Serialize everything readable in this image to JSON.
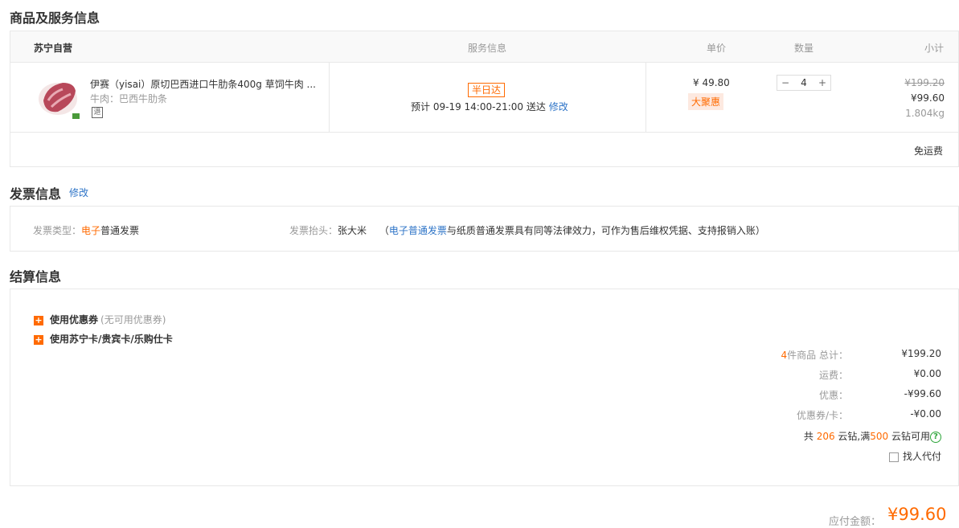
{
  "goods_section": {
    "title": "商品及服务信息",
    "header": {
      "store": "苏宁自营",
      "service": "服务信息",
      "unit_price": "单价",
      "quantity": "数量",
      "subtotal": "小计"
    },
    "item": {
      "name": "伊赛（yisai）原切巴西进口牛肋条400g 草饲牛肉 ...",
      "attr": "牛肉：巴西牛肋条",
      "return_mark": "退",
      "service_tag": "半日达",
      "delivery_prefix": "预计",
      "delivery_time": "09-19 14:00-21:00",
      "delivery_suffix": "送达",
      "modify_link": "修改",
      "price": "¥ 49.80",
      "promo_tag": "大聚惠",
      "qty_minus": "−",
      "qty_value": "4",
      "qty_plus": "+",
      "original_total": "¥199.20",
      "subtotal": "¥99.60",
      "weight": "1.804kg"
    },
    "shipping": "免运费"
  },
  "invoice_section": {
    "title": "发票信息",
    "modify_link": "修改",
    "type_label": "发票类型：",
    "type_highlight": "电子",
    "type_value": "普通发票",
    "header_label": "发票抬头：",
    "header_value": "张大米",
    "note_open": "（",
    "note_link": "电子普通发票",
    "note_text": "与纸质普通发票具有同等法律效力，可作为售后维权凭据、支持报销入账）"
  },
  "settle_section": {
    "title": "结算信息",
    "coupon_label": "使用优惠券",
    "coupon_note": "(无可用优惠券)",
    "card_label": "使用苏宁卡/贵宾卡/乐购仕卡",
    "summary": {
      "count": "4",
      "count_label": "件商品 总计：",
      "total": "¥199.20",
      "freight_label": "运费：",
      "freight": "¥0.00",
      "discount_label": "优惠：",
      "discount": "-¥99.60",
      "coupon_card_label": "优惠券/卡：",
      "coupon_card": "-¥0.00",
      "cloud_prefix": "共",
      "cloud_total": "206",
      "cloud_mid": "云钻,满",
      "cloud_min": "500",
      "cloud_suffix": "云钻可用",
      "help_glyph": "?",
      "proxy_pay": "找人代付"
    }
  },
  "payable": {
    "label": "应付金额：",
    "amount": "¥99.60"
  }
}
